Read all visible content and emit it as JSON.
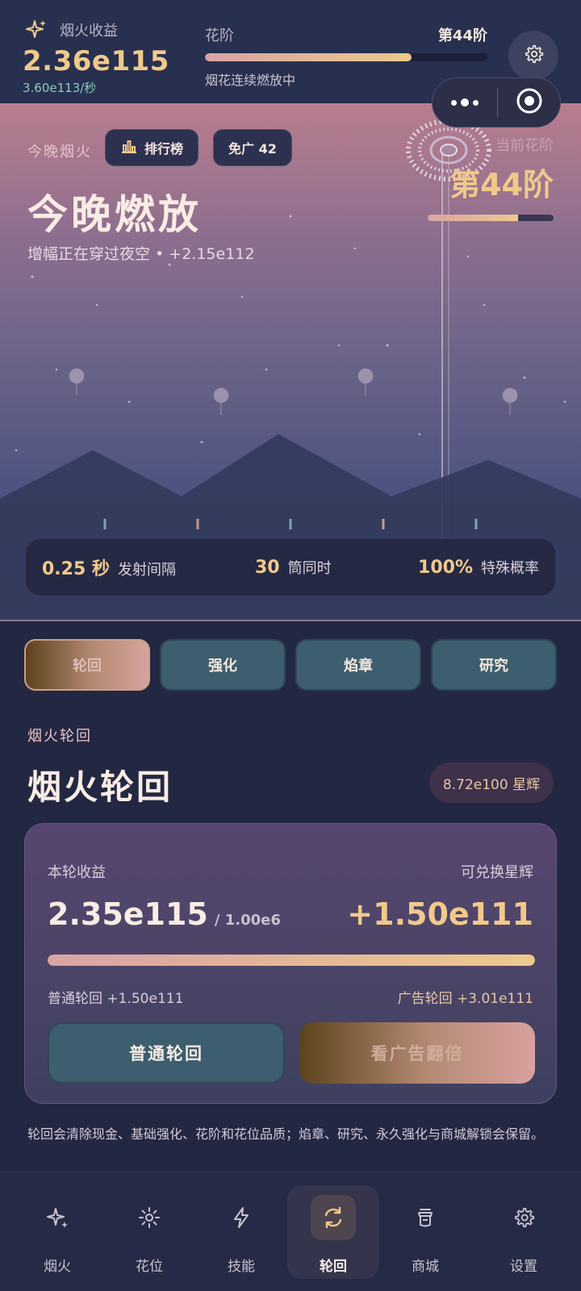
{
  "header": {
    "income_title": "烟火收益",
    "income_value": "2.36e115",
    "income_rate": "3.60e113/秒",
    "stage_label": "花阶",
    "stage_number": "第44阶",
    "stage_progress": 0.73,
    "stage_status": "烟花连续燃放中"
  },
  "scene": {
    "label": "今晚烟火",
    "leaderboard_label": "排行榜",
    "ad_free_label": "免广 42",
    "title": "今晚燃放",
    "subtitle": "增幅正在穿过夜空 • +2.15e112",
    "current_stage_label": "当前花阶",
    "current_stage_value": "第44阶",
    "current_stage_progress": 0.72
  },
  "stats": [
    {
      "value": "0.25 秒",
      "label": "发射间隔"
    },
    {
      "value": "30",
      "label": "筒同时"
    },
    {
      "value": "100%",
      "label": "特殊概率"
    }
  ],
  "tabs": [
    {
      "label": "轮回",
      "active": true
    },
    {
      "label": "强化",
      "active": false
    },
    {
      "label": "焰章",
      "active": false
    },
    {
      "label": "研究",
      "active": false
    }
  ],
  "rebirth": {
    "section_label": "烟火轮回",
    "title": "烟火轮回",
    "stardust": "8.72e100 星辉",
    "round_income_label": "本轮收益",
    "exchange_label": "可兑换星辉",
    "round_income_value": "2.35e115",
    "round_income_target": "/ 1.00e6",
    "exchange_value": "+1.50e111",
    "progress": 1.0,
    "normal_note": "普通轮回 +1.50e111",
    "ad_note": "广告轮回 +3.01e111",
    "normal_button": "普通轮回",
    "ad_button": "看广告翻倍",
    "footnote": "轮回会清除现金、基础强化、花阶和花位品质；焰章、研究、永久强化与商城解锁会保留。"
  },
  "bottom_nav": [
    {
      "label": "烟火",
      "icon": "sparkle-icon",
      "active": false
    },
    {
      "label": "花位",
      "icon": "sun-icon",
      "active": false
    },
    {
      "label": "技能",
      "icon": "lightning-icon",
      "active": false
    },
    {
      "label": "轮回",
      "icon": "refresh-icon",
      "active": true
    },
    {
      "label": "商城",
      "icon": "shop-icon",
      "active": false
    },
    {
      "label": "设置",
      "icon": "gear-icon",
      "active": false
    }
  ],
  "colors": {
    "gold": "#f0c98a",
    "teal_button": "#3c5e6e",
    "background": "#232842",
    "sky_top": "#b97d8e",
    "sky_bottom": "#323b63"
  }
}
